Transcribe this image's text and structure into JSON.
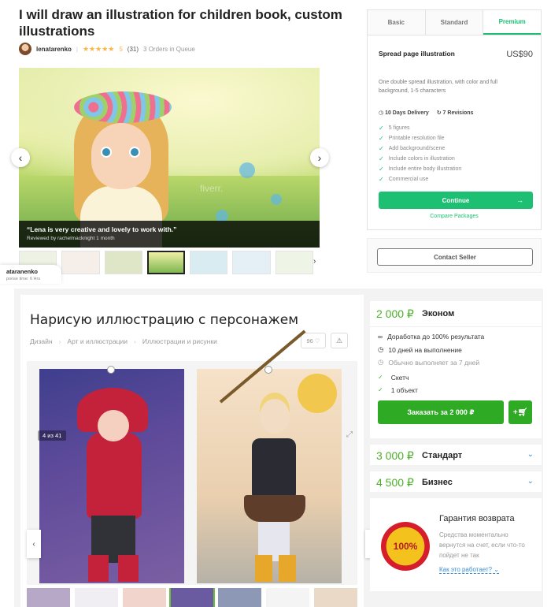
{
  "fiverr": {
    "title": "I will draw an illustration for children book, custom illustrations",
    "seller": "lenatarenko",
    "stars": "★★★★★",
    "rating": "5",
    "reviews": "(31)",
    "queue": "3 Orders in Queue",
    "review_quote": "“Lena is very creative and lovely to work with.”",
    "review_by": "Reviewed by rachelmacknight 1 month",
    "watermark": "fiverr.",
    "seller_card_name": "ataranenko",
    "seller_card_resp": "ponse time: 6 Hrs",
    "tabs": [
      "Basic",
      "Standard",
      "Premium"
    ],
    "package_name": "Spread page illustration",
    "package_price": "US$90",
    "package_desc": "One double spread illustration, with color and full background, 1-5 characters",
    "delivery": "10 Days Delivery",
    "revisions": "7 Revisions",
    "features": [
      "5 figures",
      "Printable resolution file",
      "Add background/scene",
      "Include colors in illustration",
      "Include entire body illustration",
      "Commercial use"
    ],
    "continue_label": "Continue",
    "compare_label": "Compare Packages",
    "contact_label": "Contact Seller"
  },
  "kwork": {
    "title": "Нарисую иллюстрацию с персонажем",
    "breadcrumbs": [
      "Дизайн",
      "Арт и иллюстрации",
      "Иллюстрации и рисунки"
    ],
    "likes": "96",
    "counter": "4 из 41",
    "plan1_price": "2 000 ₽",
    "plan1_name": "Эконом",
    "opt1": "Доработка до 100% результата",
    "opt2": "10 дней на выполнение",
    "opt3": "Обычно выполняет за 7 дней",
    "feat1": "Скетч",
    "feat2": "1 объект",
    "order_label": "Заказать за 2 000 ₽",
    "plan2_price": "3 000 ₽",
    "plan2_name": "Стандарт",
    "plan3_price": "4 500 ₽",
    "plan3_name": "Бизнес",
    "guarantee_title": "Гарантия возврата",
    "guarantee_text": "Средства моментально вернутся на счет, если что-то пойдет не так",
    "guarantee_link": "Как это работает?",
    "seal_text": "100%"
  },
  "colors": {
    "fiverr_green": "#1dbf73",
    "kwork_green": "#2eaa24",
    "link_blue": "#3a8ed6"
  }
}
